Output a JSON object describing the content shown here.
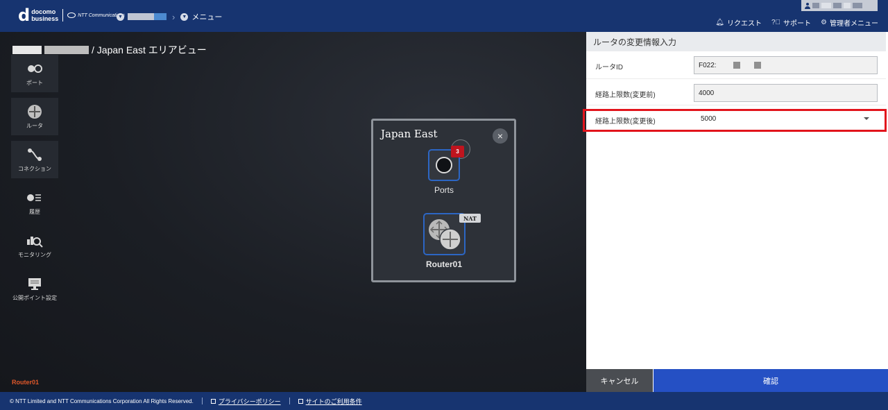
{
  "header": {
    "logo_main": "d",
    "logo_line1": "docomo",
    "logo_line2": "business",
    "ntt_logo": "NTT Communications",
    "menu_label": "メニュー",
    "links": [
      {
        "label": "リクエスト",
        "icon": "bell-icon"
      },
      {
        "label": "サポート",
        "icon": "question-icon"
      },
      {
        "label": "管理者メニュー",
        "icon": "gear-icon"
      }
    ]
  },
  "main": {
    "title_suffix": "/ Japan East エリアビュー",
    "nav": [
      {
        "label": "ポート",
        "icon": "port-icon"
      },
      {
        "label": "ルータ",
        "icon": "router-icon"
      },
      {
        "label": "コネクション",
        "icon": "connection-icon"
      },
      {
        "label": "履歴",
        "icon": "history-icon"
      },
      {
        "label": "モニタリング",
        "icon": "monitoring-icon"
      },
      {
        "label": "公開ポイント設定",
        "icon": "monitor-icon"
      }
    ],
    "selected_router": "Router01"
  },
  "area_card": {
    "title": "Japan East",
    "close_glyph": "×",
    "ports_badge": "3",
    "ports_label": "Ports",
    "nat_badge": "NAT",
    "router_label": "Router01"
  },
  "panel": {
    "title": "ルータの変更情報入力",
    "router_id_label": "ルータID",
    "router_id_value": "F022:",
    "route_limit_before_label": "経路上限数(変更前)",
    "route_limit_before_value": "4000",
    "route_limit_after_label": "経路上限数(変更後)",
    "route_limit_after_value": "5000",
    "cancel_label": "キャンセル",
    "confirm_label": "確認"
  },
  "footer": {
    "copyright": "© NTT Limited and NTT Communications Corporation All Rights Reserved.",
    "privacy_label": "プライバシーポリシー",
    "terms_label": "サイトのご利用条件"
  },
  "colors": {
    "header_bg": "#173470",
    "highlight": "#e2141c",
    "confirm_bg": "#2550c4",
    "badge_red": "#c0141e"
  }
}
